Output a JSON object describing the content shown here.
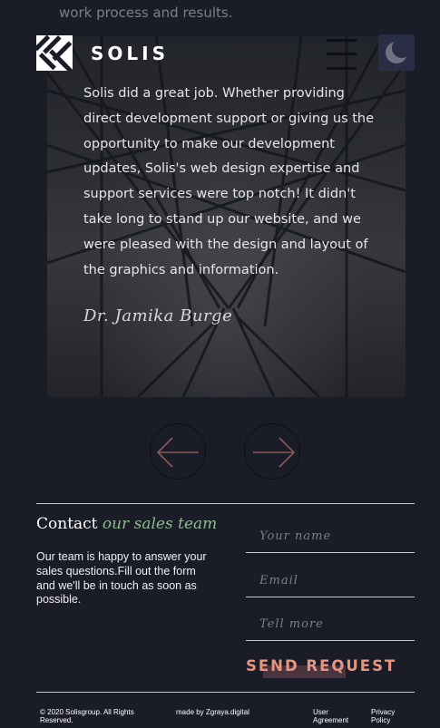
{
  "intro": {
    "text": "work process and results."
  },
  "header": {
    "brand": "SOLIS"
  },
  "testimonial": {
    "quote": "Solis did a great job. Whether providing direct development support or giving us the opportunity to make our development updates, Solis's web design expertise and support services were top notch! It didn't take long to stand up our website, and we were pleased with the design and layout of the graphics and information.",
    "author": "Dr. Jamika Burge"
  },
  "contact": {
    "title_plain": "Contact ",
    "title_accent": "our sales team",
    "description": "Our team is happy to answer your sales questions.Fill out the form and we'll be in touch as soon as possible.",
    "fields": {
      "name_placeholder": "Your name",
      "email_placeholder": "Email",
      "message_placeholder": "Tell more"
    },
    "send_label": "SEND REQUEST"
  },
  "footer": {
    "copyright_line1": "© 2020 Solisgroup. All Rights",
    "copyright_line2": "Reserved.",
    "made_by": "made by Zgraya.digital",
    "user_agreement_line1": "User",
    "user_agreement_line2": "Agreement",
    "privacy_line1": "Privacy",
    "privacy_line2": "Policy"
  },
  "colors": {
    "background": "#1a1d28",
    "accent_green": "#8dbb8f",
    "accent_salmon": "#e8957f",
    "theme_button": "#2a2e44"
  },
  "icons": {
    "logo": "woven-pattern-logo-icon",
    "menu": "hamburger-menu-icon",
    "theme": "moon-icon",
    "prev": "arrow-left-icon",
    "next": "arrow-right-icon"
  }
}
